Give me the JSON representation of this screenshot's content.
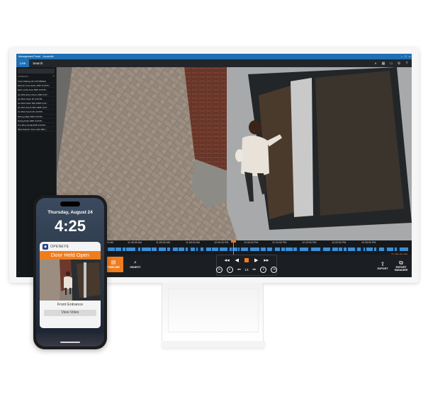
{
  "app": {
    "title": "Management Portal",
    "account": "Acmeville",
    "tabs": [
      {
        "label": "Live",
        "active": true
      },
      {
        "label": "Search",
        "active": false
      }
    ],
    "toolbar_icons": [
      "camera-icon",
      "layout-icon",
      "monitor-icon",
      "gear-icon",
      "help-icon"
    ]
  },
  "sidebar": {
    "header": "CAMERAS",
    "cameras": [
      "Front Parking 4K (C3725DE2)",
      "Exterior Front Entry 4MP (C3725...",
      "East Lobby Area 6MP (C3725...",
      "Ice Rink Entry Doors 4MP (C37...",
      "Ice Rink North 4K (C3725...",
      "Ice Rink North 360 10MP (C37...",
      "Ice Rink South 360 10MP (C37...",
      "Ice Rink South 4K (C3725...",
      "Dining Hallw 4MP (C3725...",
      "Dining Patio 6MP (C3725...",
      "Pro Shop Small 6MP (C3725...",
      "West Exterior Door Hall 4MP (..."
    ]
  },
  "timeline": {
    "ticks": [
      "11:35:00 AM",
      "11:40:00 AM",
      "11:45:00 AM",
      "11:50:00 AM",
      "11:55:00 AM",
      "12:00:00 PM",
      "12:05:00 PM",
      "12:10:00 PM",
      "12:15:00 PM",
      "12:20:00 PM",
      "12:25:00 PM"
    ],
    "current_time": "11:50:46 AM",
    "accent": "#ef7d1e",
    "recording_color": "#3a8fd6"
  },
  "controls": {
    "timeline_label": "TIMELINE",
    "object_label": "OBJECT",
    "speed_label": "1X",
    "skip_labels": [
      "15",
      "5",
      "5",
      "15"
    ],
    "export_label": "EXPORT",
    "export_manager_label": "EXPORT MANAGER"
  },
  "phone": {
    "date": "Thursday, August 24",
    "time": "4:25",
    "brand": "OPENEYE",
    "alert": "Door Held Open",
    "location": "Front Entrance",
    "button": "View Video"
  }
}
